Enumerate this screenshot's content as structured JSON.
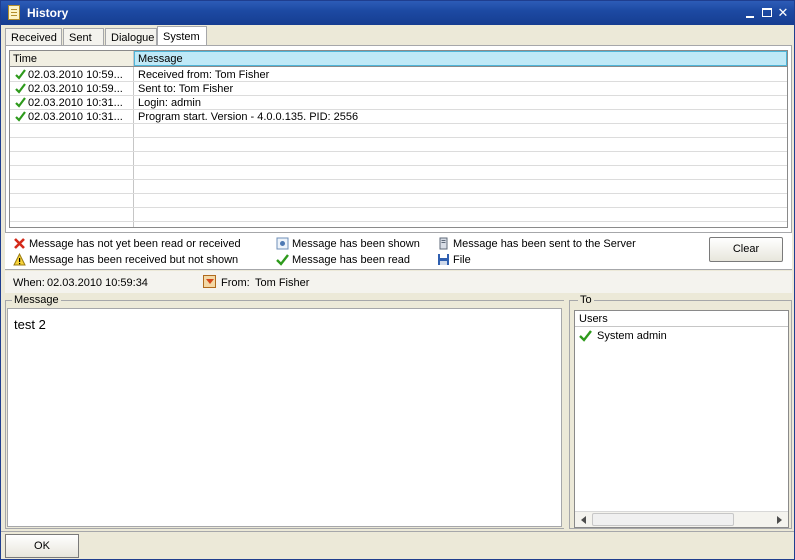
{
  "window": {
    "title": "History"
  },
  "tabs": [
    {
      "label": "Received"
    },
    {
      "label": "Sent"
    },
    {
      "label": "Dialogue"
    },
    {
      "label": "System"
    }
  ],
  "grid": {
    "headers": {
      "time": "Time",
      "message": "Message"
    },
    "rows": [
      {
        "time": "02.03.2010 10:59...",
        "message": "Received from: Tom Fisher",
        "icon": "green-check-icon"
      },
      {
        "time": "02.03.2010 10:59...",
        "message": "Sent to: Tom Fisher",
        "icon": "green-check-icon"
      },
      {
        "time": "02.03.2010 10:31...",
        "message": "Login: admin",
        "icon": "green-check-icon"
      },
      {
        "time": "02.03.2010 10:31...",
        "message": "Program start. Version - 4.0.0.135. PID: 2556",
        "icon": "green-check-icon"
      }
    ]
  },
  "legend": {
    "not_read": "Message has not yet been read or received",
    "received_not_shown": "Message has been received but not shown",
    "shown": "Message has been shown",
    "read": "Message has been read",
    "sent_server": "Message has been sent to the Server",
    "file": "File",
    "clear_label": "Clear"
  },
  "info": {
    "when_label": "When:",
    "when_value": "02.03.2010 10:59:34",
    "from_label": "From:",
    "from_value": "Tom Fisher"
  },
  "message": {
    "caption": "Message",
    "text": "test 2"
  },
  "to": {
    "caption": "To",
    "header": "Users",
    "users": [
      {
        "name": "System admin"
      }
    ]
  },
  "footer": {
    "ok_label": "OK"
  },
  "colors": {
    "titlebar": "#1d4aa3",
    "check": "#2e9a1c",
    "header_highlight": "#bfe9f7"
  }
}
